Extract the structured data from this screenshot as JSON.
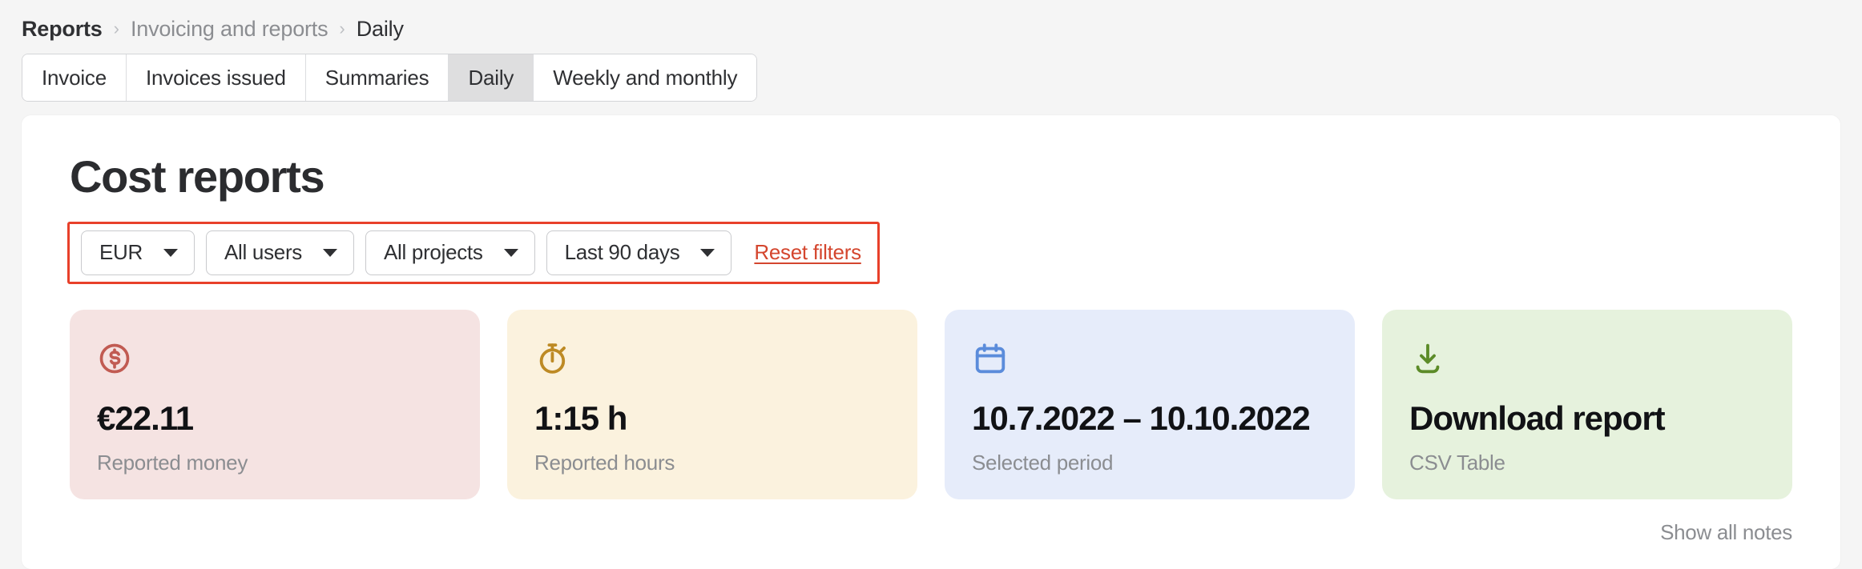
{
  "breadcrumb": {
    "separator": "›",
    "items": [
      {
        "label": "Reports",
        "current": false
      },
      {
        "label": "Invoicing and reports",
        "current": false
      },
      {
        "label": "Daily",
        "current": true
      }
    ]
  },
  "tabs": [
    {
      "label": "Invoice",
      "active": false
    },
    {
      "label": "Invoices issued",
      "active": false
    },
    {
      "label": "Summaries",
      "active": false
    },
    {
      "label": "Daily",
      "active": true
    },
    {
      "label": "Weekly and monthly",
      "active": false
    }
  ],
  "page": {
    "title": "Cost reports",
    "show_all_notes": "Show all notes"
  },
  "filters": {
    "highlight_color": "#e8402a",
    "currency": {
      "value": "EUR",
      "icon": "chevron-down-icon"
    },
    "users": {
      "value": "All users",
      "icon": "chevron-down-icon"
    },
    "projects": {
      "value": "All projects",
      "icon": "chevron-down-icon"
    },
    "period": {
      "value": "Last 90 days",
      "icon": "chevron-down-icon"
    },
    "reset": {
      "label": "Reset filters",
      "color": "#d4462e"
    }
  },
  "cards": [
    {
      "icon": "dollar-circle-icon",
      "icon_color": "#c15b52",
      "background": "#f5e3e2",
      "value": "€22.11",
      "label": "Reported money"
    },
    {
      "icon": "stopwatch-icon",
      "icon_color": "#bd8a24",
      "background": "#fbf2de",
      "value": "1:15 h",
      "label": "Reported hours"
    },
    {
      "icon": "calendar-icon",
      "icon_color": "#5b8cdb",
      "background": "#e6ecfa",
      "value": "10.7.2022 – 10.10.2022",
      "label": "Selected period"
    },
    {
      "icon": "download-icon",
      "icon_color": "#5c8b28",
      "background": "#e6f2dd",
      "value": "Download report",
      "label": "CSV Table"
    }
  ]
}
